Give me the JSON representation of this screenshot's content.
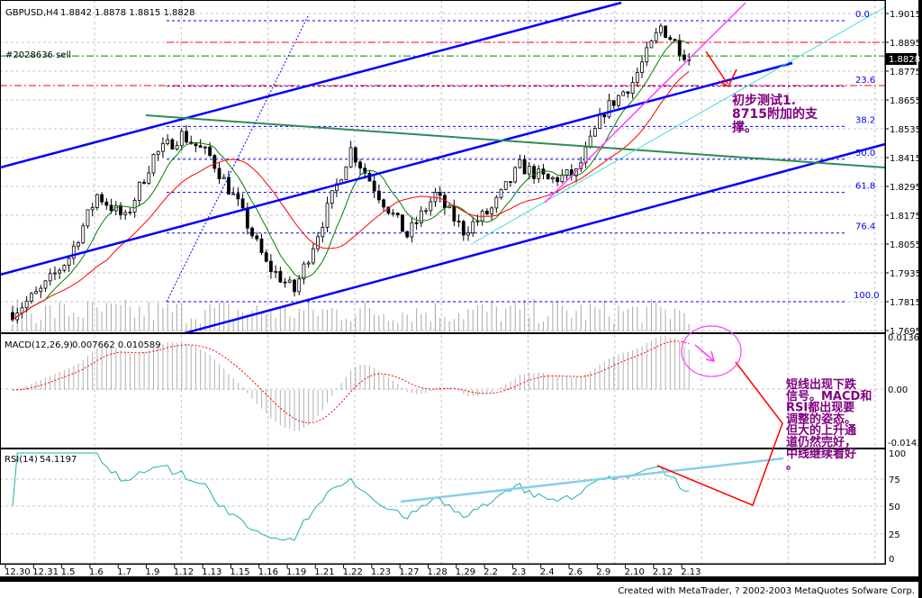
{
  "header": {
    "symbol": "GBPUSD,H4",
    "ohlc": "1.8842 1.8878 1.8815 1.8828",
    "order_label": "#2028636 sell",
    "current_price": "1.8828"
  },
  "macd": {
    "label": "MACD(12,26,9)",
    "values": "0.007662  0.010589",
    "ticks": [
      "0.01360",
      "0.00",
      "-0.01433"
    ]
  },
  "rsi": {
    "label": "RSI(14)",
    "value": "54.1197",
    "ticks": [
      "100",
      "75",
      "50",
      "25",
      "0"
    ]
  },
  "annotations": {
    "support_note": [
      "初步测试1.",
      "8715附加的支",
      "撑。"
    ],
    "signal_note": [
      "短线出现下跌",
      "信号。MACD和",
      "RSI都出现要",
      "调整的姿态。",
      "但大的上升通",
      "道仍然完好，",
      "中线继续看好",
      "。"
    ]
  },
  "footer": "Created with MetaTrader, ? 2002-2003 MetaQuotes Sofware Corp.",
  "colors": {
    "channel": "#0000ff",
    "green_line": "#2e8b57",
    "cyan": "#40e0d0",
    "magenta": "#ff40ff",
    "red": "#ff0000",
    "note": "#800080",
    "fast_ma": "#008000",
    "slow_ma": "#ff0000"
  },
  "chart_data": {
    "type": "candlestick",
    "title": "GBPUSD,H4",
    "x_tick_labels": [
      "12.30",
      "12.31",
      "1.5",
      "1.6",
      "1.7",
      "1.9",
      "1.12",
      "1.13",
      "1.15",
      "1.16",
      "1.19",
      "1.21",
      "1.22",
      "1.23",
      "1.27",
      "1.28",
      "1.29",
      "2.2",
      "2.3",
      "2.4",
      "2.6",
      "2.9",
      "2.10",
      "2.12",
      "2.13"
    ],
    "close_at_ticks": [
      1.777,
      1.786,
      1.8,
      1.826,
      1.816,
      1.842,
      1.851,
      1.842,
      1.822,
      1.797,
      1.786,
      1.815,
      1.845,
      1.826,
      1.809,
      1.826,
      1.811,
      1.82,
      1.838,
      1.832,
      1.835,
      1.861,
      1.873,
      1.896,
      1.8828
    ],
    "y_tick_labels": [
      "1.9015",
      "1.8895",
      "1.8775",
      "1.8655",
      "1.8535",
      "1.8415",
      "1.8295",
      "1.8175",
      "1.8055",
      "1.7935",
      "1.7815",
      "1.7695"
    ],
    "ylim": [
      1.7695,
      1.9075
    ],
    "fibonacci": {
      "levels": [
        "0.0",
        "23.6",
        "38.2",
        "50.0",
        "61.8",
        "76.4",
        "100.0"
      ],
      "prices": [
        1.8985,
        1.8712,
        1.8545,
        1.8408,
        1.827,
        1.8101,
        1.7815
      ]
    },
    "horizontal_lines": {
      "sell_order_price": 1.8895,
      "order_stop": 1.8842,
      "support": 1.8715
    },
    "macd_range": [
      -0.01433,
      0.0136
    ],
    "rsi_range": [
      0,
      100
    ]
  }
}
